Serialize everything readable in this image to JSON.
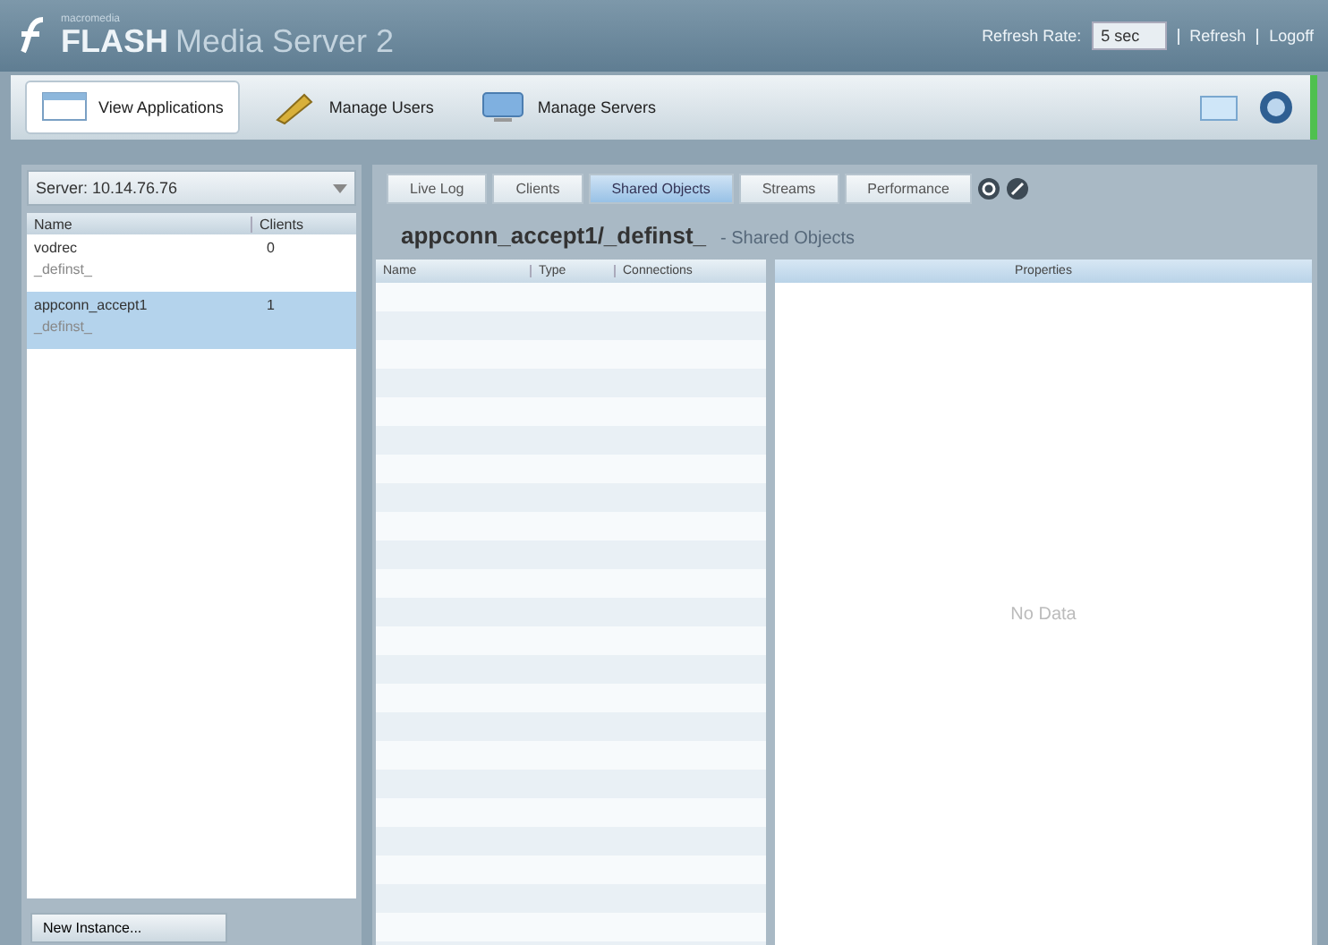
{
  "header": {
    "logo_small": "macromedia",
    "logo": "FLASH",
    "logo_rest": "Media Server 2",
    "refresh_label": "Refresh Rate:",
    "refresh_value": "5 sec",
    "links": [
      "Refresh",
      "Logoff"
    ]
  },
  "toolbar": [
    {
      "label": "View Applications",
      "selected": true,
      "kind": "apps"
    },
    {
      "label": "Manage Users",
      "selected": false,
      "kind": "users"
    },
    {
      "label": "Manage Servers",
      "selected": false,
      "kind": "servers"
    }
  ],
  "sidebar": {
    "server": "Server: 10.14.76.76",
    "columns": [
      "Name",
      "Clients"
    ],
    "rows": [
      {
        "name": "vodrec",
        "instance": "_definst_",
        "clients": "0",
        "selected": false
      },
      {
        "name": "appconn_accept1",
        "instance": "_definst_",
        "clients": "1",
        "selected": true
      }
    ],
    "new_button": "New Instance..."
  },
  "tabs": [
    {
      "label": "Live Log",
      "selected": false
    },
    {
      "label": "Clients",
      "selected": false
    },
    {
      "label": "Shared Objects",
      "selected": true
    },
    {
      "label": "Streams",
      "selected": false
    },
    {
      "label": "Performance",
      "selected": false
    }
  ],
  "title": "appconn_accept1/_definst_",
  "subtitle": "- Shared Objects",
  "table": {
    "columns": [
      "Name",
      "Type",
      "Connections"
    ]
  },
  "properties": {
    "title": "Properties",
    "empty": "No Data"
  }
}
